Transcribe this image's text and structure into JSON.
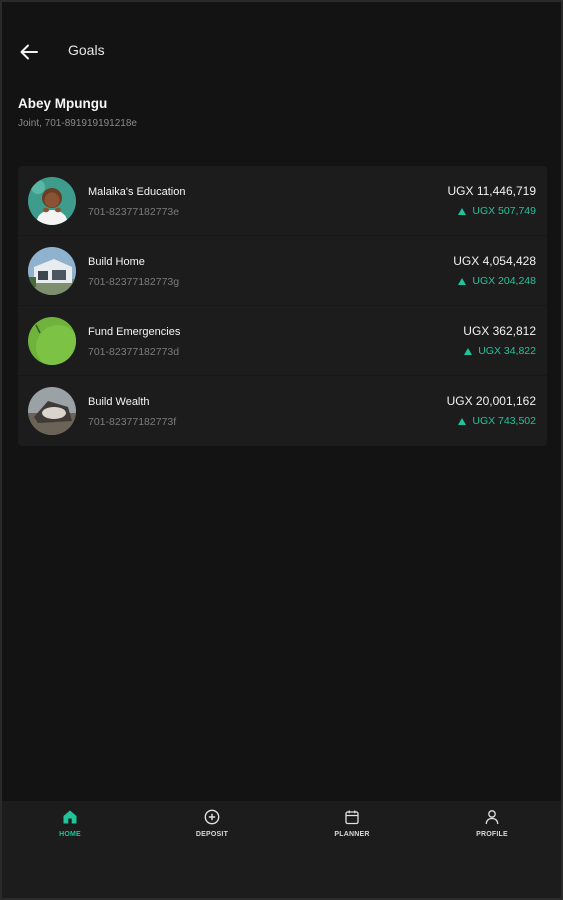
{
  "header": {
    "title": "Goals",
    "back_icon": "arrow-left-icon"
  },
  "account": {
    "name": "Abey Mpungu",
    "subtitle": "Joint, 701-891919191218e"
  },
  "goals": [
    {
      "name": "Malaika's Education",
      "account": "701-82377182773e",
      "amount": "UGX 11,446,719",
      "change": "UGX 507,749",
      "trend": "up"
    },
    {
      "name": "Build Home",
      "account": "701-82377182773g",
      "amount": "UGX 4,054,428",
      "change": "UGX 204,248",
      "trend": "up"
    },
    {
      "name": "Fund Emergencies",
      "account": "701-82377182773d",
      "amount": "UGX 362,812",
      "change": "UGX 34,822",
      "trend": "up"
    },
    {
      "name": "Build Wealth",
      "account": "701-82377182773f",
      "amount": "UGX 20,001,162",
      "change": "UGX 743,502",
      "trend": "up"
    }
  ],
  "nav": [
    {
      "label": "HOME",
      "icon": "home-icon",
      "active": true
    },
    {
      "label": "DEPOSIT",
      "icon": "plus-circle-icon",
      "active": false
    },
    {
      "label": "PLANNER",
      "icon": "calendar-icon",
      "active": false
    },
    {
      "label": "PROFILE",
      "icon": "user-icon",
      "active": false
    }
  ],
  "colors": {
    "accent": "#22c39a",
    "background": "#131313",
    "card": "#1c1c1c"
  }
}
